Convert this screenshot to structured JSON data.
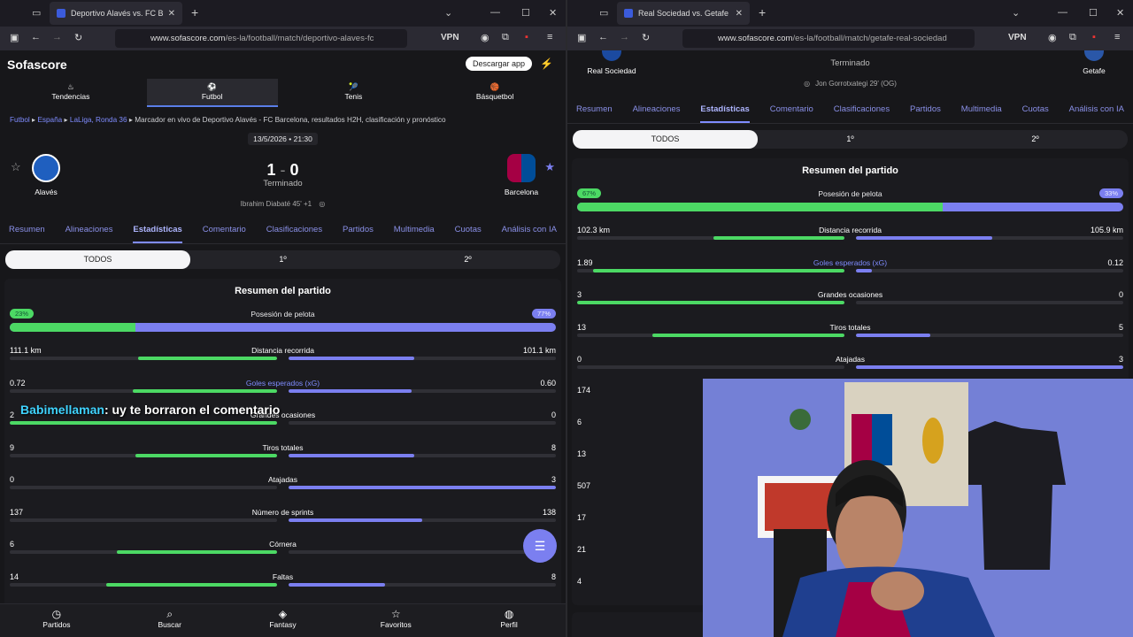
{
  "left": {
    "tab_title": "Deportivo Alavés vs. FC Barcelona",
    "url_main": "www.sofascore.com",
    "url_path": "/es-la/football/match/deportivo-alaves-fc",
    "vpn": "VPN",
    "logo": "Sofascore",
    "download": "Descargar app",
    "sports": [
      "Tendencias",
      "Futbol",
      "Tenis",
      "Básquetbol"
    ],
    "crumbs": {
      "a": "Futbol",
      "b": "España",
      "c": "LaLiga, Ronda 36",
      "text": "Marcador en vivo de Deportivo Alavés - FC Barcelona, resultados H2H, clasificación y pronóstico"
    },
    "datetime": "13/5/2026 • 21:30",
    "home": "Alavés",
    "away": "Barcelona",
    "score_home": "1",
    "score_away": "0",
    "status": "Terminado",
    "scorer": "Ibrahim Diabaté 45' +1",
    "tabs": [
      "Resumen",
      "Alineaciones",
      "Estadísticas",
      "Comentario",
      "Clasificaciones",
      "Partidos",
      "Multimedia",
      "Cuotas",
      "Análisis con IA"
    ],
    "periods": [
      "TODOS",
      "1º",
      "2º"
    ],
    "summary_title": "Resumen del partido",
    "possession": {
      "label": "Posesión de pelota",
      "home": "23%",
      "away": "77%",
      "home_value": 23
    },
    "stats": [
      {
        "name": "Distancia recorrida",
        "home": "111.1 km",
        "away": "101.1 km",
        "hf": 0.52,
        "af": 0.47
      },
      {
        "name": "Goles esperados (xG)",
        "home": "0.72",
        "away": "0.60",
        "hf": 0.54,
        "af": 0.46
      },
      {
        "name": "Grandes ocasiones",
        "home": "2",
        "away": "0",
        "hf": 1.0,
        "af": 0.0
      },
      {
        "name": "Tiros totales",
        "home": "9",
        "away": "8",
        "hf": 0.53,
        "af": 0.47
      },
      {
        "name": "Atajadas",
        "home": "0",
        "away": "3",
        "hf": 0.0,
        "af": 1.0
      },
      {
        "name": "Número de sprints",
        "home": "137",
        "away": "138",
        "hf": 0.0,
        "af": 0.5
      },
      {
        "name": "Córnera",
        "home": "6",
        "away": "",
        "hf": 0.6,
        "af": 0.0
      },
      {
        "name": "Faltas",
        "home": "14",
        "away": "8",
        "hf": 0.64,
        "af": 0.36
      }
    ],
    "bottom_nav": [
      "Partidos",
      "Buscar",
      "Fantasy",
      "Favoritos",
      "Perfil"
    ],
    "chat_user": "Babimellaman",
    "chat_text": ": uy te borraron el comentario"
  },
  "right": {
    "tab_title": "Real Sociedad vs. Getafe resultados",
    "url_main": "www.sofascore.com",
    "url_path": "/es-la/football/match/getafe-real-sociedad",
    "vpn": "VPN",
    "home": "Real Sociedad",
    "away": "Getafe",
    "status": "Terminado",
    "scorer": "Jon Gorrotxategi 29' (OG)",
    "tabs": [
      "Resumen",
      "Alineaciones",
      "Estadísticas",
      "Comentario",
      "Clasificaciones",
      "Partidos",
      "Multimedia",
      "Cuotas",
      "Análisis con IA"
    ],
    "periods": [
      "TODOS",
      "1º",
      "2º"
    ],
    "summary_title": "Resumen del partido",
    "possession": {
      "label": "Posesión de pelota",
      "home": "67%",
      "away": "33%",
      "home_value": 67
    },
    "stats": [
      {
        "name": "Distancia recorrida",
        "home": "102.3 km",
        "away": "105.9 km",
        "hf": 0.49,
        "af": 0.51
      },
      {
        "name": "Goles esperados (xG)",
        "home": "1.89",
        "away": "0.12",
        "hf": 0.94,
        "af": 0.06
      },
      {
        "name": "Grandes ocasiones",
        "home": "3",
        "away": "0",
        "hf": 1.0,
        "af": 0.0
      },
      {
        "name": "Tiros totales",
        "home": "13",
        "away": "5",
        "hf": 0.72,
        "af": 0.28
      },
      {
        "name": "Atajadas",
        "home": "0",
        "away": "3",
        "hf": 0.0,
        "af": 1.0
      }
    ],
    "extra_values": [
      "174",
      "6",
      "13",
      "507",
      "17",
      "21",
      "4"
    ]
  },
  "colors": {
    "home": "#4cd964",
    "away": "#7b7ff0",
    "link": "#7f8cff"
  }
}
